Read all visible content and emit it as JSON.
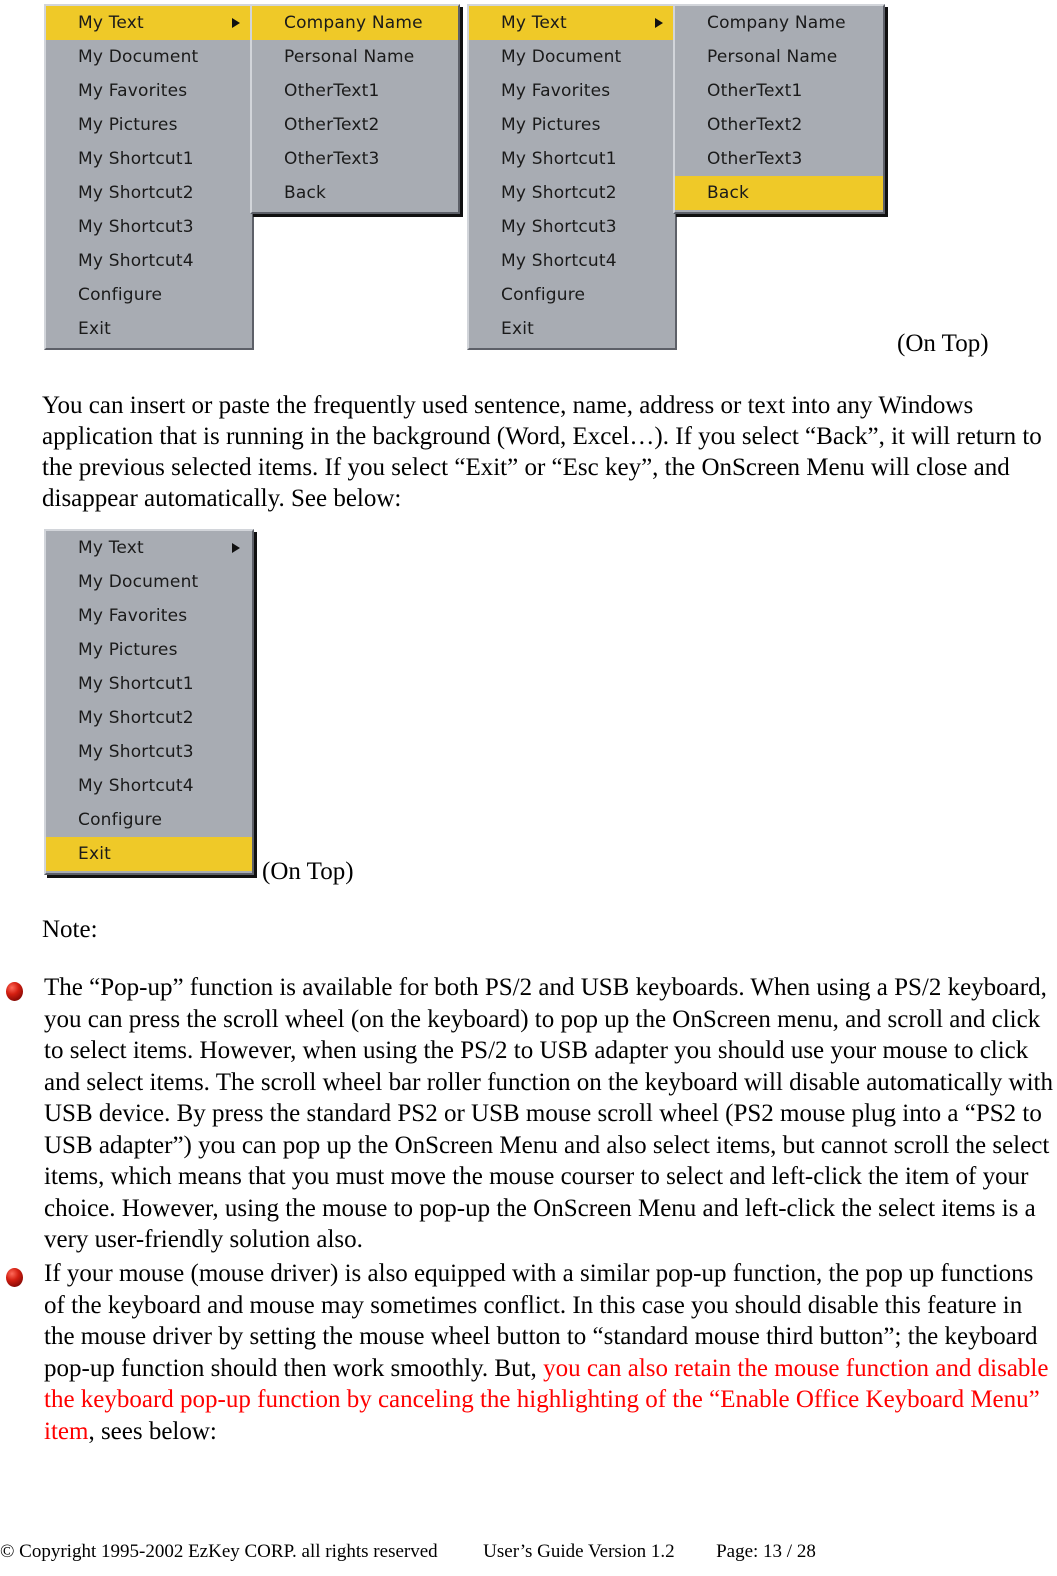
{
  "menus": {
    "main_items": [
      {
        "label": "My Text",
        "has_submenu": true
      },
      {
        "label": "My Document",
        "has_submenu": false
      },
      {
        "label": "My Favorites",
        "has_submenu": false
      },
      {
        "label": "My Pictures",
        "has_submenu": false
      },
      {
        "label": "My Shortcut1",
        "has_submenu": false
      },
      {
        "label": "My Shortcut2",
        "has_submenu": false
      },
      {
        "label": "My Shortcut3",
        "has_submenu": false
      },
      {
        "label": "My Shortcut4",
        "has_submenu": false
      },
      {
        "label": "Configure",
        "has_submenu": false
      },
      {
        "label": "Exit",
        "has_submenu": false
      }
    ],
    "submenu_items": [
      {
        "label": "Company Name"
      },
      {
        "label": "Personal Name"
      },
      {
        "label": "OtherText1"
      },
      {
        "label": "OtherText2"
      },
      {
        "label": "OtherText3"
      },
      {
        "label": "Back"
      }
    ],
    "colors": {
      "highlight": "#efc928",
      "face": "#a8acb3",
      "text": "#1a1a1a"
    },
    "figure1": {
      "main_highlight": "My Text",
      "submenu_highlight": "Company Name"
    },
    "figure2": {
      "main_highlight": "My Text",
      "submenu_highlight": "Back",
      "caption": "(On Top)"
    },
    "figure3": {
      "main_highlight": "Exit",
      "caption": "(On Top)"
    }
  },
  "body": {
    "intro_paragraph": "You can insert or paste the frequently used sentence, name, address or text into any Windows application that is running in the background (Word, Excel…). If you select “Back”, it will return to the previous selected items. If you select “Exit” or “Esc key”, the OnScreen Menu will close and disappear automatically. See below:",
    "note_label": "Note:",
    "bullets": [
      {
        "text": "The “Pop-up” function is available for both PS/2 and USB keyboards. When using a PS/2 keyboard, you can press the scroll wheel (on the keyboard) to pop up the OnScreen menu, and scroll and click to select items. However, when using the PS/2 to USB adapter you should use your mouse to click and select items. The scroll wheel bar roller function on the keyboard will disable automatically with USB device. By press the standard PS2 or USB mouse scroll wheel (PS2 mouse plug into a “PS2 to USB adapter”) you can pop up the OnScreen Menu and also select items, but cannot scroll the select items, which means that you must move the mouse courser to select and left-click the item of your choice. However, using the mouse to pop-up the OnScreen Menu and left-click the select items is a very user-friendly solution also."
      },
      {
        "text_black_1": "If your mouse (mouse driver) is also equipped with a similar pop-up function, the pop up functions of the keyboard and mouse may sometimes conflict. In this case you should disable this feature in the mouse driver by setting the mouse wheel button to “standard mouse third button”; the keyboard pop-up function should then work smoothly. But, ",
        "text_red": "you can also retain the mouse function and disable the keyboard pop-up function by canceling the highlighting of the “Enable Office Keyboard Menu” item",
        "text_black_2": ", sees below:"
      }
    ]
  },
  "footer": {
    "copyright": "© Copyright 1995-2002 EzKey CORP. all rights reserved",
    "guide": "User’s Guide Version 1.2",
    "page": "Page: 13 / 28"
  }
}
